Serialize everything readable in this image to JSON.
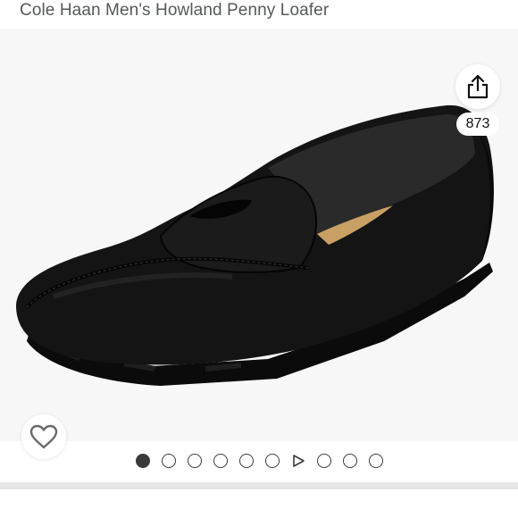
{
  "product": {
    "title": "Cole Haan Men's Howland Penny Loafer"
  },
  "share": {
    "icon": "share-icon",
    "count": "873"
  },
  "wishlist": {
    "icon": "heart-outline-icon"
  },
  "carousel": {
    "total_items": 10,
    "active_index": 0,
    "video_index": 6
  },
  "colors": {
    "title_text": "#565959",
    "image_background": "#f7f7f7",
    "dot": "#3a3a3a",
    "shoe": "#141414"
  }
}
